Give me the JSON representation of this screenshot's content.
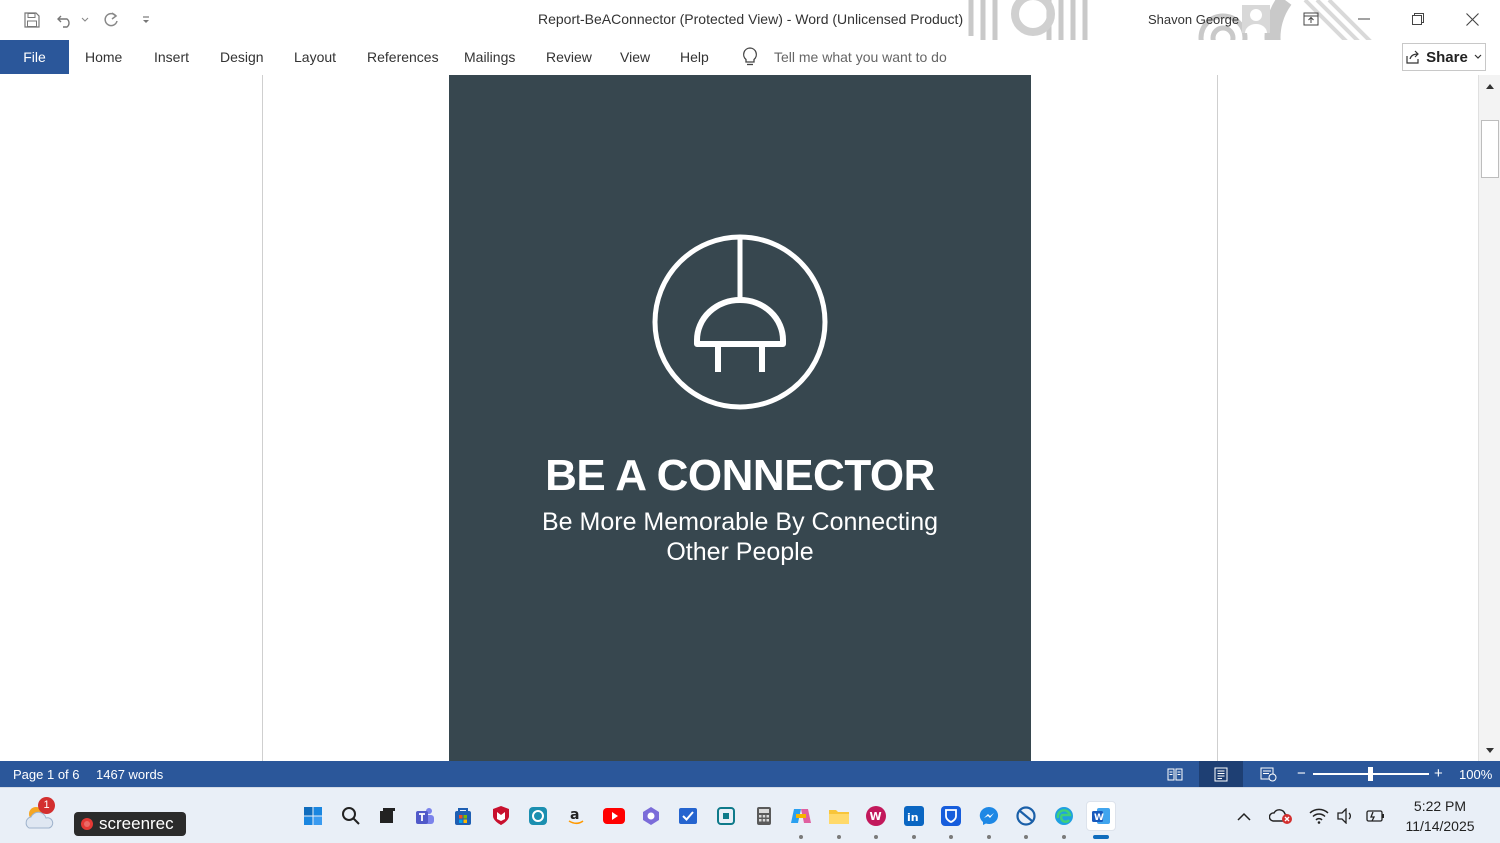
{
  "window": {
    "title": "Report-BeAConnector (Protected View)  -  Word (Unlicensed Product)",
    "user": "Shavon George",
    "share_label": "Share"
  },
  "ribbon": {
    "file_label": "File",
    "tabs": [
      "Home",
      "Insert",
      "Design",
      "Layout",
      "References",
      "Mailings",
      "Review",
      "View",
      "Help"
    ],
    "tell_me_placeholder": "Tell me what you want to do"
  },
  "document": {
    "cover_title": "BE A CONNECTOR",
    "cover_subtitle_line1": "Be More Memorable By Connecting",
    "cover_subtitle_line2": "Other People",
    "cover_color": "#37474f"
  },
  "status_bar": {
    "page": "Page 1 of 6",
    "words": "1467 words",
    "zoom": "100%",
    "zoom_level": 1.0
  },
  "taskbar": {
    "screenrec_label": "screenrec",
    "weather_badge": "1",
    "time": "5:22 PM",
    "date": "11/14/2025",
    "apps": [
      "start-icon",
      "search-icon",
      "task-view-icon",
      "teams-icon",
      "store-icon",
      "mcafee-icon",
      "app-icon",
      "amazon-icon",
      "youtube-icon",
      "app-icon",
      "todo-icon",
      "app-icon",
      "calculator-icon",
      "copilot-icon",
      "file-explorer-icon",
      "app-icon",
      "linkedin-icon",
      "bitwarden-icon",
      "messenger-icon",
      "app-icon",
      "edge-icon",
      "word-icon"
    ]
  },
  "colors": {
    "word_blue": "#2b579a",
    "taskbar": "#e9eff7"
  }
}
